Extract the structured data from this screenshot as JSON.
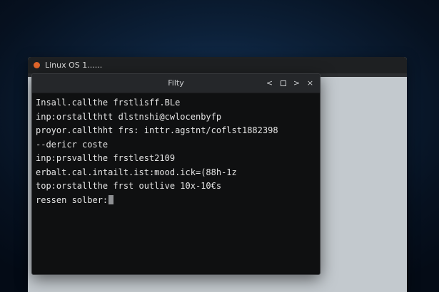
{
  "background_window": {
    "title": "Linux OS 1......",
    "accent_color": "#e2662a"
  },
  "terminal": {
    "title": "Filty",
    "controls": {
      "prev": "<",
      "next": ">",
      "close": "×"
    },
    "lines": [
      "Insall.callthe frstlisff.BLe",
      "inp:orstallthtt dlstnshi@cwlocenbyfp",
      "proyor.callthht frs: inttr.agstnt/coflst1882398",
      "--dericr coste",
      "inp:prsvallthe frstlest2109",
      "erbalt.cal.intailt.ist:mood.ick=(88h-1z",
      "top:orstallthe frst outlive 10x-10€s",
      "ressen solber:"
    ]
  }
}
